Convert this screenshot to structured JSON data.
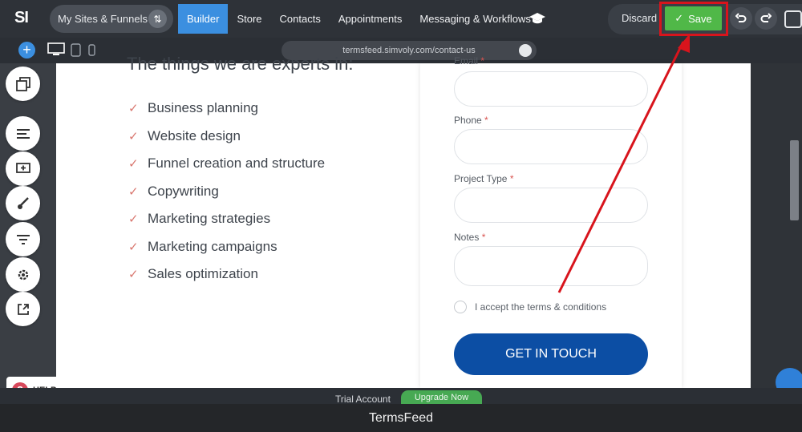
{
  "app": {
    "logo": "SI"
  },
  "header": {
    "sites_button": "My Sites & Funnels",
    "nav": [
      "Builder",
      "Store",
      "Contacts",
      "Appointments",
      "Messaging & Workflows"
    ],
    "active_nav": "Builder",
    "discard_label": "Discard",
    "save_label": "Save"
  },
  "toolbar": {
    "url": "termsfeed.simvoly.com/contact-us"
  },
  "content": {
    "experts_title": "The things we are experts in:",
    "services": [
      "Business planning",
      "Website design",
      "Funnel creation and structure",
      "Copywriting",
      "Marketing strategies",
      "Marketing campaigns",
      "Sales optimization"
    ]
  },
  "form": {
    "email_label": "Email",
    "phone_label": "Phone",
    "project_type_label": "Project Type",
    "notes_label": "Notes",
    "required_mark": "*",
    "accept_label": "I accept the terms & conditions",
    "submit_label": "GET IN TOUCH"
  },
  "help": {
    "label": "HELP"
  },
  "footer": {
    "trial_label": "Trial Account",
    "upgrade_label": "Upgrade Now",
    "caption": "TermsFeed"
  },
  "colors": {
    "accent_blue": "#3b8fe0",
    "save_green": "#50b848",
    "highlight_red": "#d8141c",
    "cta_blue": "#0c4ea4"
  }
}
